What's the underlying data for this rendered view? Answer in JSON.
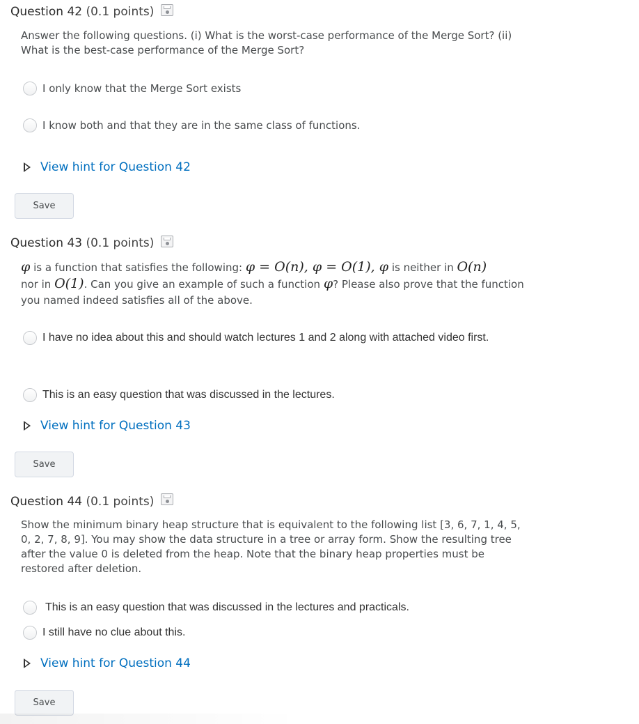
{
  "questions": [
    {
      "title": "Question 42",
      "points": "(0.1 points)",
      "text": "Answer the following questions. (i) What is the worst-case performance of the Merge Sort? (ii) What is the best-case performance of the Merge Sort?",
      "options": [
        "I only know that the Merge Sort exists",
        "I know both and that they are in the same class of functions."
      ],
      "hint": "View hint for Question 42",
      "save": "Save"
    },
    {
      "title": "Question 43",
      "points": "(0.1 points)",
      "text_parts": {
        "phi": "φ",
        "t1": " is a function that satisfies the following: ",
        "eq1": "φ = O(n), φ = O(1), φ",
        "t2": " is neither in ",
        "on": "O(n)",
        "t3": "nor in ",
        "o1": "O(1)",
        "t4": ". Can you give an example of such a function ",
        "phi2": "φ",
        "t5": "? Please also prove that the function you named indeed satisfies all of the above."
      },
      "options": [
        "I have no idea about this and should watch lectures 1 and 2 along with attached video first.",
        "This is an easy question that was discussed in the lectures."
      ],
      "hint": "View hint for Question 43",
      "save": "Save"
    },
    {
      "title": "Question 44",
      "points": "(0.1 points)",
      "text": "Show the minimum binary heap structure that is equivalent to the following list [3, 6, 7, 1, 4, 5, 0, 2, 7, 8, 9]. You may show the data structure in a tree or array form. Show the resulting tree after the value 0 is deleted from the heap. Note that the binary heap properties must be restored after deletion.",
      "options": [
        "This is an easy question that was discussed in the lectures and practicals.",
        "I still have no clue about this."
      ],
      "hint": "View hint for Question 44",
      "save": "Save"
    }
  ],
  "icons": {
    "save_draft": "floppy-disk-icon",
    "hint_toggle": "triangle-right-icon"
  },
  "colors": {
    "link": "#006fbf",
    "text": "#494c4e",
    "button_bg": "#f1f3f5"
  }
}
